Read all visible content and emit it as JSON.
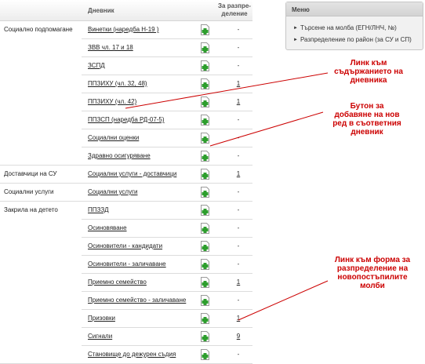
{
  "header": {
    "log_col": "Дневник",
    "dist_col_line1": "За разпре-",
    "dist_col_line2": "деление"
  },
  "rows": [
    {
      "category": "Социално подпомагане",
      "label": "Винетки (наредба Н-19 )",
      "count": "-"
    },
    {
      "category": "",
      "label": "ЗВВ чл. 17 и 18",
      "count": "-"
    },
    {
      "category": "",
      "label": "ЗСПД",
      "count": "-"
    },
    {
      "category": "",
      "label": "ППЗИХУ (чл. 32, 48)",
      "count": "1"
    },
    {
      "category": "",
      "label": "ППЗИХУ (чл. 42)",
      "count": "1"
    },
    {
      "category": "",
      "label": "ППЗСП (наредба РД-07-5)",
      "count": "-"
    },
    {
      "category": "",
      "label": "Социални оценки",
      "count": "-"
    },
    {
      "category": "",
      "label": "Здравно осигуряване",
      "count": "-"
    },
    {
      "category": "Доставчици на СУ",
      "label": "Социални услуги - доставчици",
      "count": "1"
    },
    {
      "category": "Социални услуги",
      "label": "Социални услуги",
      "count": "-"
    },
    {
      "category": "Закрила на детето",
      "label": "ППЗЗД",
      "count": "-"
    },
    {
      "category": "",
      "label": "Осиновяване",
      "count": "-"
    },
    {
      "category": "",
      "label": "Осиновители - кандидати",
      "count": "-"
    },
    {
      "category": "",
      "label": "Осиновители - заличаване",
      "count": "-"
    },
    {
      "category": "",
      "label": "Приемно семейство",
      "count": "1"
    },
    {
      "category": "",
      "label": "Приемно семейство - заличаване",
      "count": "-"
    },
    {
      "category": "",
      "label": "Призовки",
      "count": "1"
    },
    {
      "category": "",
      "label": "Сигнали",
      "count": "9"
    },
    {
      "category": "",
      "label": "Становище до дежурен съдия",
      "count": "-"
    }
  ],
  "menu": {
    "title": "Меню",
    "items": [
      "Търсене на молба (ЕГН/ЛНЧ, №)",
      "Разпределение по район (за СУ и СП)"
    ]
  },
  "annotations": {
    "log_link": [
      "Линк към",
      "съдържанието на",
      "дневника"
    ],
    "add_button": [
      "Бутон за",
      "добавяне на нов",
      "ред в съответния",
      "дневник"
    ],
    "dist_link": [
      "Линк към форма за",
      "разпределение на",
      "новопостъпилите",
      "молби"
    ]
  },
  "colors": {
    "annotation": "#cc0000",
    "add_icon": "#2e9e2e"
  }
}
